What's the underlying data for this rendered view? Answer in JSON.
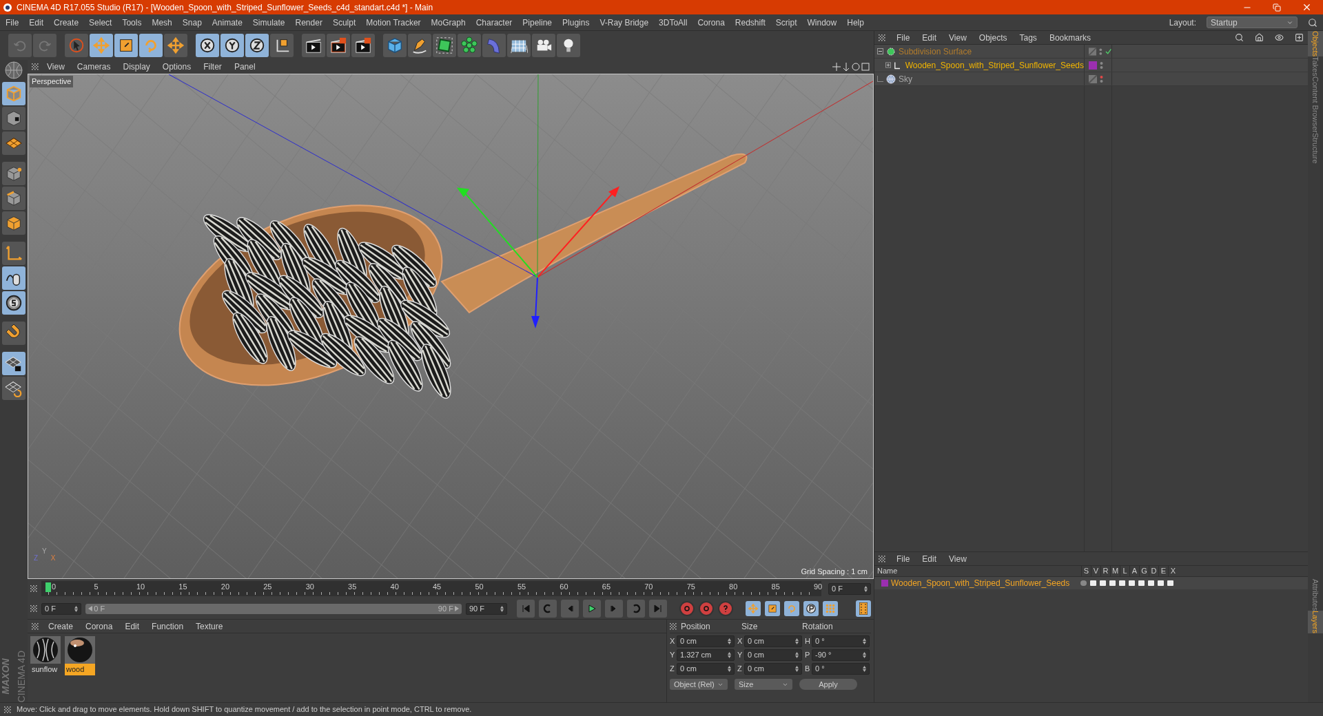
{
  "window": {
    "title": "CINEMA 4D R17.055 Studio (R17) - [Wooden_Spoon_with_Striped_Sunflower_Seeds_c4d_standart.c4d *] - Main"
  },
  "menu": [
    "File",
    "Edit",
    "Create",
    "Select",
    "Tools",
    "Mesh",
    "Snap",
    "Animate",
    "Simulate",
    "Render",
    "Sculpt",
    "Motion Tracker",
    "MoGraph",
    "Character",
    "Pipeline",
    "Plugins",
    "V-Ray Bridge",
    "3DToAll",
    "Corona",
    "Redshift",
    "Script",
    "Window",
    "Help"
  ],
  "layout": {
    "label": "Layout:",
    "value": "Startup"
  },
  "toolbar": [
    {
      "kind": "undo",
      "selected": false
    },
    {
      "kind": "redo",
      "selected": false
    },
    {
      "kind": "sep"
    },
    {
      "kind": "select",
      "selected": false
    },
    {
      "kind": "move",
      "selected": true
    },
    {
      "kind": "scale",
      "selected": true
    },
    {
      "kind": "rotate",
      "selected": true
    },
    {
      "kind": "add",
      "selected": false
    },
    {
      "kind": "sep"
    },
    {
      "kind": "x",
      "selected": true
    },
    {
      "kind": "y",
      "selected": true
    },
    {
      "kind": "z",
      "selected": true
    },
    {
      "kind": "coord",
      "selected": false
    },
    {
      "kind": "sep"
    },
    {
      "kind": "render-view",
      "selected": false
    },
    {
      "kind": "render",
      "selected": false
    },
    {
      "kind": "render-settings",
      "selected": false
    },
    {
      "kind": "sep"
    },
    {
      "kind": "cube",
      "selected": false
    },
    {
      "kind": "pen",
      "selected": false
    },
    {
      "kind": "subdivision",
      "selected": false
    },
    {
      "kind": "cloner",
      "selected": false
    },
    {
      "kind": "deformer",
      "selected": false
    },
    {
      "kind": "floor",
      "selected": false
    },
    {
      "kind": "camera",
      "selected": false
    },
    {
      "kind": "light",
      "selected": false
    }
  ],
  "left_tools": [
    {
      "kind": "model",
      "selected": true
    },
    {
      "kind": "texture",
      "selected": false
    },
    {
      "kind": "workplane",
      "selected": false
    },
    {
      "kind": "sep"
    },
    {
      "kind": "points",
      "selected": false
    },
    {
      "kind": "edges",
      "selected": false
    },
    {
      "kind": "polygons",
      "selected": false
    },
    {
      "kind": "sep"
    },
    {
      "kind": "axis",
      "selected": false
    },
    {
      "kind": "tweak",
      "selected": true
    },
    {
      "kind": "snap",
      "selected": true
    },
    {
      "kind": "sep"
    },
    {
      "kind": "magnet",
      "selected": false
    },
    {
      "kind": "sep"
    },
    {
      "kind": "lock-workplane",
      "selected": true
    },
    {
      "kind": "grid-rotate",
      "selected": false
    }
  ],
  "viewport": {
    "menu": [
      "View",
      "Cameras",
      "Display",
      "Options",
      "Filter",
      "Panel"
    ],
    "camera": "Perspective",
    "grid_spacing": "Grid Spacing : 1 cm",
    "axis_labels": [
      "Z",
      "Y",
      "X"
    ]
  },
  "object_manager": {
    "menu": [
      "File",
      "Edit",
      "View",
      "Objects",
      "Tags",
      "Bookmarks"
    ],
    "objects": [
      {
        "name": "Subdivision Surface",
        "kind": "subdivision",
        "color": "#b27c2c",
        "expanded": true,
        "children": [
          {
            "name": "Wooden_Spoon_with_Striped_Sunflower_Seeds",
            "kind": "null",
            "color": "#f2b500",
            "expanded": false,
            "layer": {
              "color": "#9b2fb0"
            }
          }
        ]
      },
      {
        "name": "Sky",
        "kind": "sky",
        "color": "#a8a8a8"
      }
    ]
  },
  "side_tabs_top": [
    {
      "label": "Objects",
      "selected": true
    },
    {
      "label": "Takes",
      "selected": false
    },
    {
      "label": "Content Browser",
      "selected": false
    },
    {
      "label": "Structure",
      "selected": false
    }
  ],
  "side_tabs_bottom": [
    {
      "label": "Attributes",
      "selected": false
    },
    {
      "label": "Layers",
      "selected": true
    }
  ],
  "timeline": {
    "ticks": [
      "0",
      "5",
      "10",
      "15",
      "20",
      "25",
      "30",
      "35",
      "40",
      "45",
      "50",
      "55",
      "60",
      "65",
      "70",
      "75",
      "80",
      "85",
      "90"
    ],
    "level": 0,
    "frame": "0 F",
    "start": "0 F",
    "range": {
      "start": "0 F",
      "end": "90 F",
      "level": 1
    },
    "end": "90 F"
  },
  "material_manager": {
    "menu": [
      "Create",
      "Corona",
      "Edit",
      "Function",
      "Texture"
    ],
    "materials": [
      {
        "name": "sunflow",
        "kind": "striped",
        "selected": false
      },
      {
        "name": "wood",
        "kind": "glossy",
        "selected": true
      }
    ]
  },
  "coordinates": {
    "headers": [
      "Position",
      "Size",
      "Rotation"
    ],
    "rows": [
      [
        {
          "axis": "X",
          "value": "0 cm"
        },
        {
          "axis": "X",
          "value": "0 cm"
        },
        {
          "axis": "H",
          "value": "0 °"
        }
      ],
      [
        {
          "axis": "Y",
          "value": "1.327 cm"
        },
        {
          "axis": "Y",
          "value": "0 cm"
        },
        {
          "axis": "P",
          "value": "-90 °"
        }
      ],
      [
        {
          "axis": "Z",
          "value": "0 cm"
        },
        {
          "axis": "Z",
          "value": "0 cm"
        },
        {
          "axis": "B",
          "value": "0 °"
        }
      ]
    ],
    "mode": "Object (Rel)",
    "size_mode": "Size",
    "apply": "Apply"
  },
  "layer_manager": {
    "menu": [
      "File",
      "Edit",
      "View"
    ],
    "columns": [
      "Name",
      "S",
      "V",
      "R",
      "M",
      "L",
      "A",
      "G",
      "D",
      "E",
      "X"
    ],
    "layers": [
      {
        "name": "Wooden_Spoon_with_Striped_Sunflower_Seeds",
        "color": "#9b2fb0"
      }
    ]
  },
  "logo": {
    "brand": "MAXON",
    "product": "CINEMA 4D"
  },
  "status_bar": "Move: Click and drag to move elements. Hold down SHIFT to quantize movement / add to the selection in point mode, CTRL to remove."
}
